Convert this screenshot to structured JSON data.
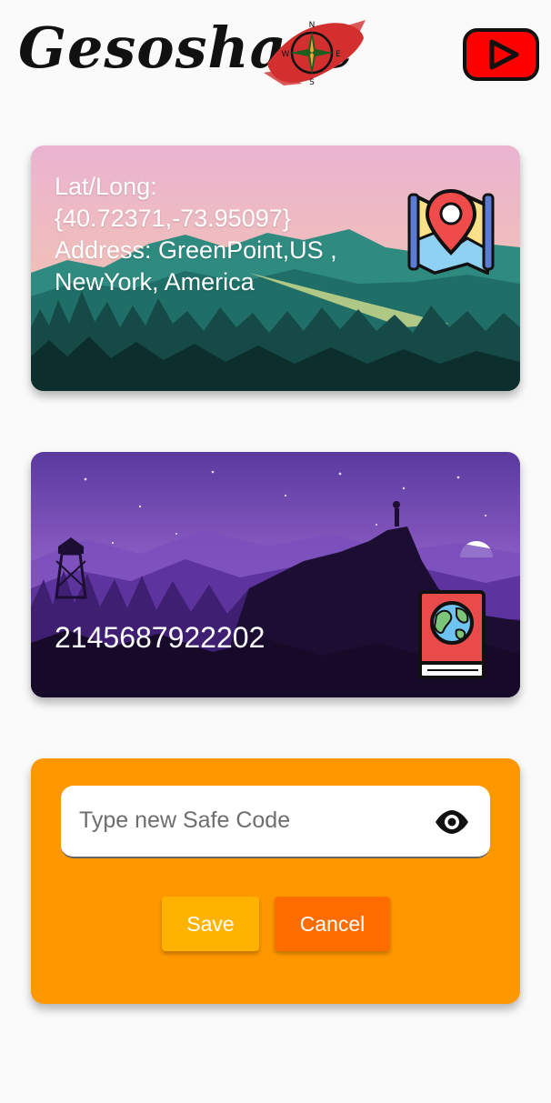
{
  "app": {
    "title": "Gesoshare",
    "compass_letters": {
      "n": "N",
      "e": "E",
      "s": "S",
      "w": "W"
    },
    "brand_red": "#d32f2f"
  },
  "header": {
    "youtube_icon": "youtube-play-icon"
  },
  "location_card": {
    "lat_long_label": "Lat/Long:",
    "coordinates": "{40.72371,-73.95097}",
    "address_line1": "Address: GreenPoint,US ,",
    "address_line2": "NewYork, America",
    "icon": "map-pin-icon"
  },
  "code_card": {
    "code": "2145687922202",
    "icon": "passport-globe-icon"
  },
  "safe_code": {
    "placeholder": "Type new Safe Code",
    "value": "",
    "eye_icon": "eye-icon",
    "save_label": "Save",
    "cancel_label": "Cancel",
    "panel_color": "#ff9800",
    "save_color": "#ffb300",
    "cancel_color": "#ff6d00"
  }
}
